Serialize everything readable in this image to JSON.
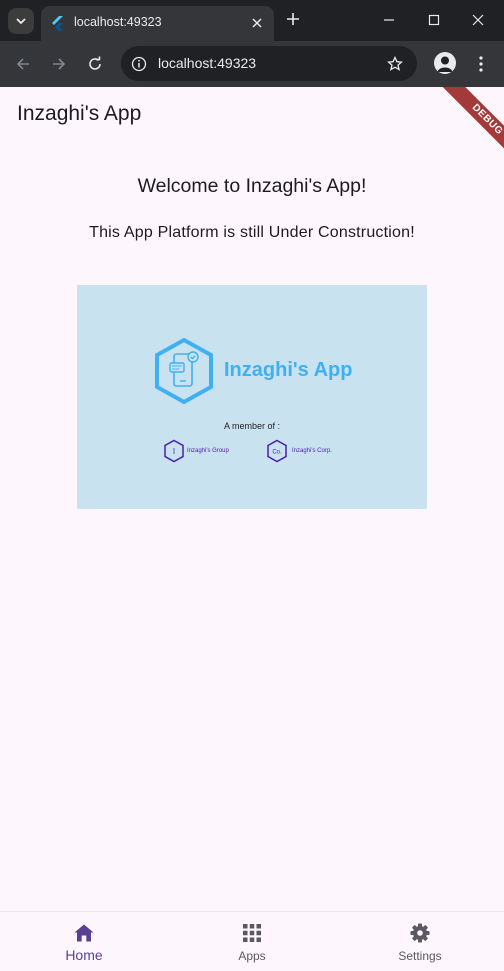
{
  "browser": {
    "tab_title": "localhost:49323",
    "url": "localhost:49323"
  },
  "app": {
    "title": "Inzaghi's App",
    "debug_label": "DEBUG",
    "welcome": "Welcome to Inzaghi's App!",
    "subtitle": "This App Platform is still Under Construction!",
    "banner": {
      "brand_name": "Inzaghi's App",
      "member_of": "A member of :",
      "members": [
        {
          "icon_text": "I",
          "label": "Inzaghi's Group"
        },
        {
          "icon_text": "Co.",
          "label": "Inzaghi's Corp."
        }
      ]
    }
  },
  "bottom_nav": {
    "items": [
      {
        "label": "Home",
        "icon": "home-icon",
        "active": true
      },
      {
        "label": "Apps",
        "icon": "apps-grid-icon",
        "active": false
      },
      {
        "label": "Settings",
        "icon": "gear-icon",
        "active": false
      }
    ]
  },
  "colors": {
    "accent": "#5a3f93",
    "brand_blue": "#3fb0f2",
    "banner_bg": "#c8e2ef",
    "debug_ribbon": "#a23a3a"
  }
}
